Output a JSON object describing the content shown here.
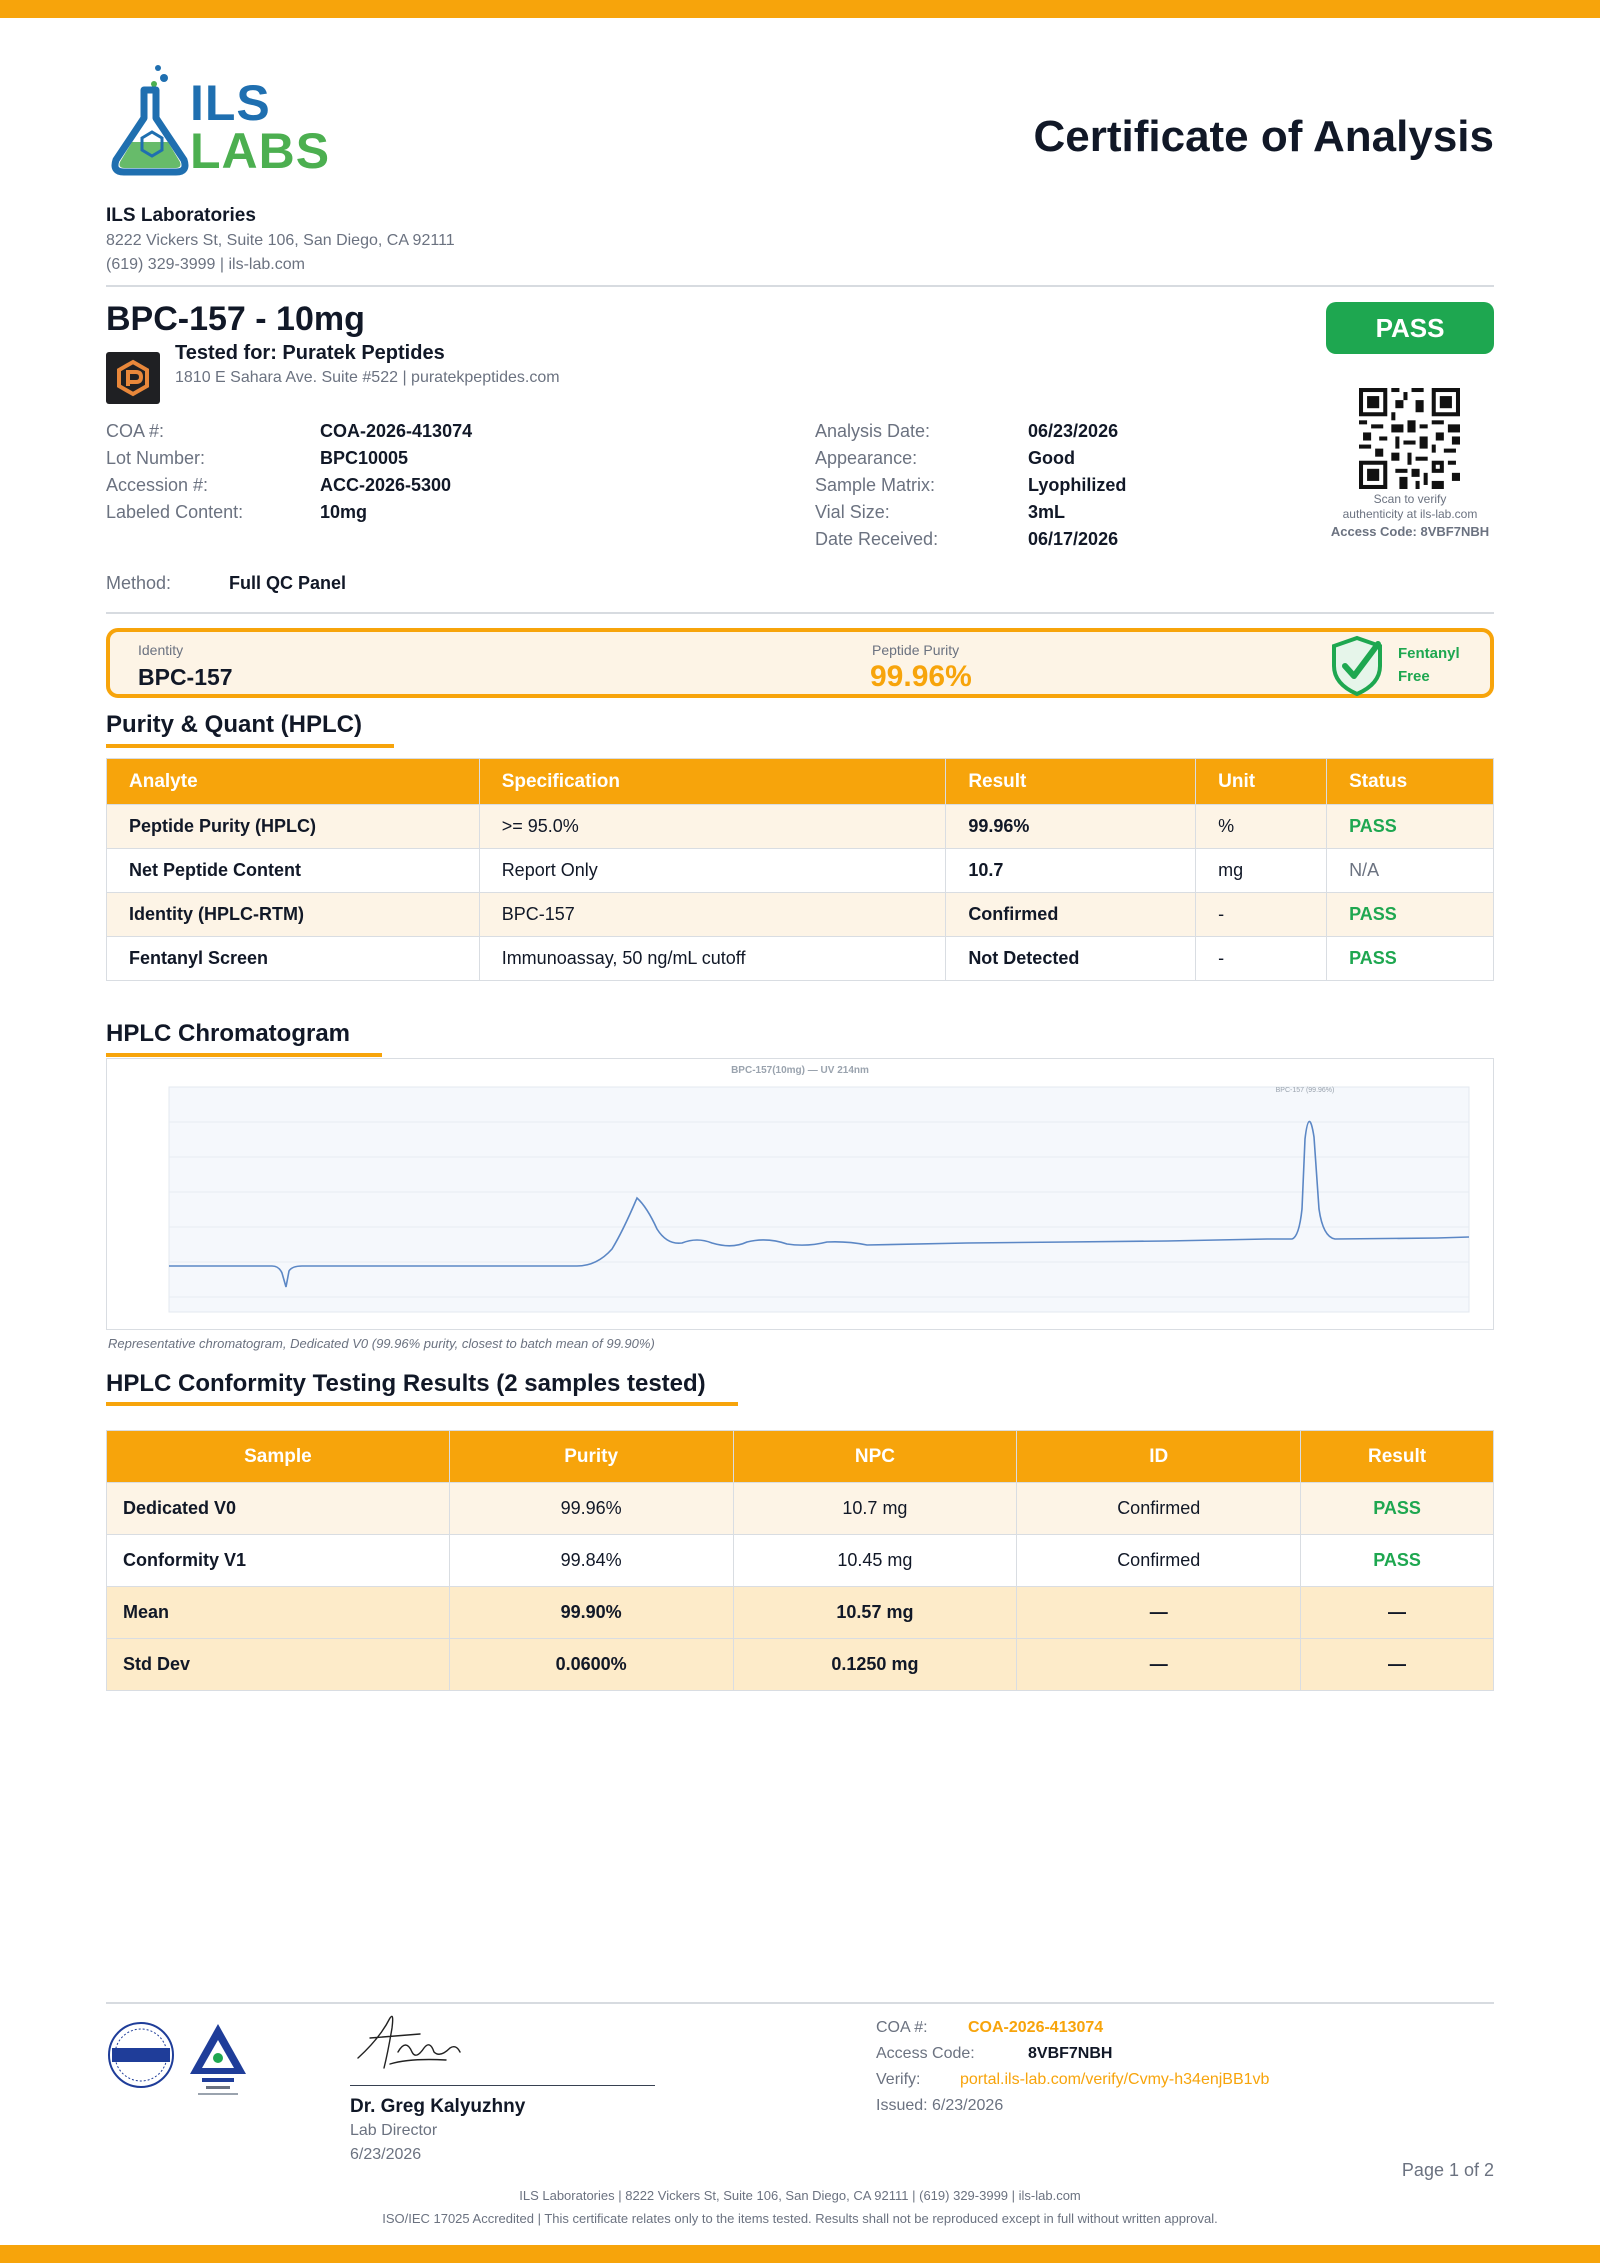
{
  "header": {
    "logo_text_line1": "ILS",
    "logo_text_line2": "LABS",
    "doc_title": "Certificate of Analysis",
    "lab_name": "ILS Laboratories",
    "lab_address": "8222 Vickers St, Suite 106, San Diego, CA 92111",
    "lab_contact": "(619) 329-3999  |  ils-lab.com"
  },
  "product": {
    "title": "BPC-157 - 10mg",
    "tested_for": "Tested for: Puratek Peptides",
    "client_address": "1810 E Sahara Ave. Suite #522  |  puratekpeptides.com",
    "overall_status": "PASS",
    "qr_caption_1": "Scan to verify",
    "qr_caption_2": "authenticity at ils-lab.com",
    "access_code_caption": "Access Code: 8VBF7NBH"
  },
  "details_left": [
    {
      "label": "COA #:",
      "value": "COA-2026-413074"
    },
    {
      "label": "Lot Number:",
      "value": "BPC10005"
    },
    {
      "label": "Accession #:",
      "value": "ACC-2026-5300"
    },
    {
      "label": "Labeled Content:",
      "value": "10mg"
    }
  ],
  "details_right": [
    {
      "label": "Analysis Date:",
      "value": "06/23/2026"
    },
    {
      "label": "Appearance:",
      "value": "Good"
    },
    {
      "label": "Sample Matrix:",
      "value": "Lyophilized"
    },
    {
      "label": "Vial Size:",
      "value": "3mL"
    },
    {
      "label": "Date Received:",
      "value": "06/17/2026"
    }
  ],
  "method": {
    "label": "Method:",
    "value": "Full QC Panel"
  },
  "summary": {
    "identity_label": "Identity",
    "identity_value": "BPC-157",
    "purity_label": "Peptide Purity",
    "purity_value": "99.96%",
    "fentanyl_line1": "Fentanyl",
    "fentanyl_line2": "Free"
  },
  "purity_section": {
    "title": "Purity & Quant (HPLC)",
    "columns": [
      "Analyte",
      "Specification",
      "Result",
      "Unit",
      "Status"
    ],
    "rows": [
      [
        "Peptide Purity (HPLC)",
        ">= 95.0%",
        "99.96%",
        "%",
        "PASS"
      ],
      [
        "Net Peptide Content",
        "Report Only",
        "10.7",
        "mg",
        "N/A"
      ],
      [
        "Identity (HPLC-RTM)",
        "BPC-157",
        "Confirmed",
        "-",
        "PASS"
      ],
      [
        "Fentanyl Screen",
        "Immunoassay, 50 ng/mL cutoff",
        "Not Detected",
        "-",
        "PASS"
      ]
    ]
  },
  "chromatogram": {
    "title": "HPLC Chromatogram",
    "plot_title": "BPC-157(10mg) — UV 214nm",
    "peak_label": "BPC-157 (99.96%)",
    "caption": "Representative chromatogram, Dedicated V0 (99.96% purity, closest to batch mean of 99.90%)"
  },
  "conformity_section": {
    "title": "HPLC Conformity Testing Results (2 samples tested)",
    "columns": [
      "Sample",
      "Purity",
      "NPC",
      "ID",
      "Result"
    ],
    "rows": [
      [
        "Dedicated V0",
        "99.96%",
        "10.7 mg",
        "Confirmed",
        "PASS"
      ],
      [
        "Conformity V1",
        "99.84%",
        "10.45 mg",
        "Confirmed",
        "PASS"
      ],
      [
        "Mean",
        "99.90%",
        "10.57 mg",
        "—",
        "—"
      ],
      [
        "Std Dev",
        "0.0600%",
        "0.1250 mg",
        "—",
        "—"
      ]
    ]
  },
  "footer": {
    "signer_name": "Dr. Greg Kalyuzhny",
    "signer_role": "Lab Director",
    "signer_date": "6/23/2026",
    "coa_label": "COA #:",
    "coa_value": "COA-2026-413074",
    "access_label": "Access Code:",
    "access_value": "8VBF7NBH",
    "verify_label": "Verify:",
    "verify_value": "portal.ils-lab.com/verify/Cvmy-h34enjBB1vb",
    "issued": "Issued: 6/23/2026",
    "page": "Page 1 of 2",
    "line1": "ILS Laboratories  |  8222 Vickers St, Suite 106, San Diego, CA 92111  |  (619) 329-3999  |  ils-lab.com",
    "line2": "ISO/IEC 17025 Accredited  |  This certificate relates only to the items tested. Results shall not be reproduced except in full without written approval."
  },
  "colors": {
    "accent": "#f7a40b",
    "pass": "#1ea750",
    "brand_blue": "#1f6fb0",
    "brand_green": "#4caf50"
  }
}
